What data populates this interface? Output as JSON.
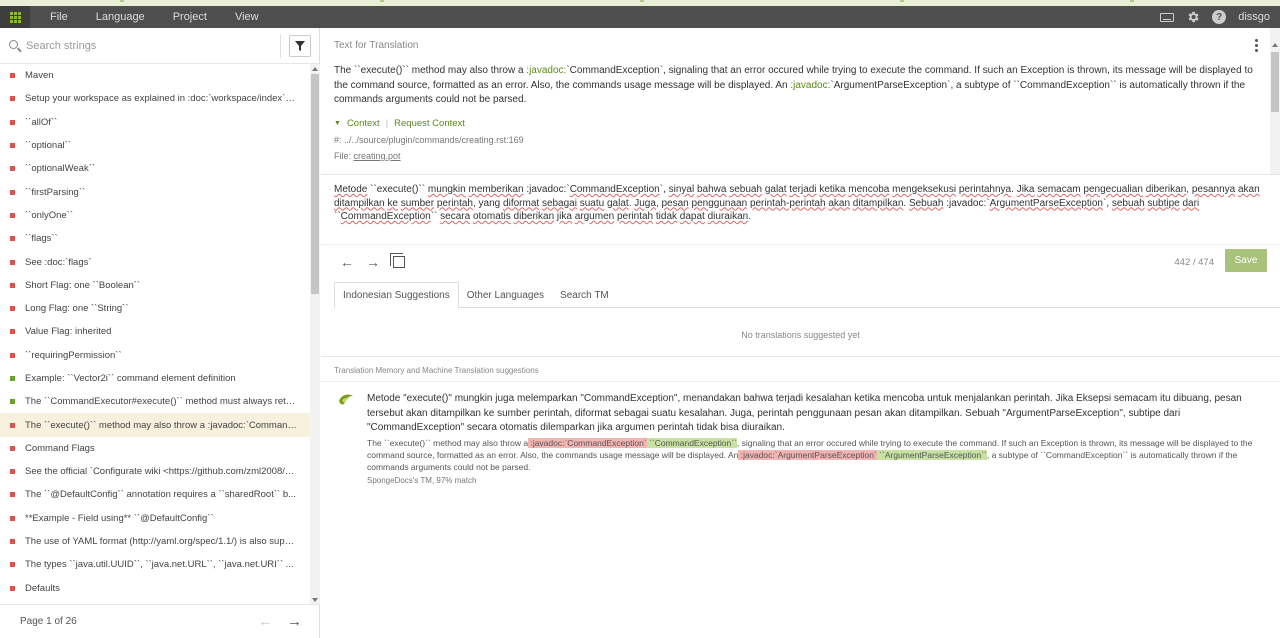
{
  "menubar": {
    "items": [
      "File",
      "Language",
      "Project",
      "View"
    ],
    "user": "dissgo",
    "help_label": "?"
  },
  "sidebar": {
    "search_placeholder": "Search strings",
    "items": [
      {
        "text": "Maven",
        "status": "untranslated"
      },
      {
        "text": "Setup your workspace as explained in :doc:`workspace/index` then...",
        "status": "untranslated"
      },
      {
        "text": "``allOf``",
        "status": "untranslated"
      },
      {
        "text": "``optional``",
        "status": "untranslated"
      },
      {
        "text": "``optionalWeak``",
        "status": "untranslated"
      },
      {
        "text": "``firstParsing``",
        "status": "untranslated"
      },
      {
        "text": "``onlyOne``",
        "status": "untranslated"
      },
      {
        "text": "``flags``",
        "status": "untranslated"
      },
      {
        "text": "See :doc:`flags`",
        "status": "untranslated"
      },
      {
        "text": "Short Flag: one ``Boolean``",
        "status": "untranslated"
      },
      {
        "text": "Long Flag: one ``String``",
        "status": "untranslated"
      },
      {
        "text": "Value Flag: inherited",
        "status": "untranslated"
      },
      {
        "text": "``requiringPermission``",
        "status": "untranslated"
      },
      {
        "text": "Example: ``Vector2i`` command element definition",
        "status": "translated"
      },
      {
        "text": "The ``CommandExecutor#execute()`` method must always return...",
        "status": "translated"
      },
      {
        "text": "The ``execute()`` method may also throw a :javadoc:`Command...",
        "status": "untranslated",
        "active": true
      },
      {
        "text": "Command Flags",
        "status": "untranslated"
      },
      {
        "text": "See the official `Configurate wiki <https://github.com/zml2008/co...",
        "status": "untranslated"
      },
      {
        "text": "The ``@DefaultConfig`` annotation requires a ``sharedRoot`` b...",
        "status": "untranslated"
      },
      {
        "text": "**Example - Field using** ``@DefaultConfig``",
        "status": "untranslated"
      },
      {
        "text": "The use of YAML format (http://yaml.org/spec/1.1/) is also support...",
        "status": "untranslated"
      },
      {
        "text": "The types ``java.util.UUID``, ``java.net.URL``, ``java.net.URI`` ...",
        "status": "untranslated"
      },
      {
        "text": "Defaults",
        "status": "untranslated"
      }
    ],
    "pager": "Page 1 of 26",
    "prev_icon": "←",
    "next_icon": "→"
  },
  "colors": {
    "untranslated": "#d9534f",
    "translated": "#6aa32b",
    "accent": "#5b8a15",
    "save_button": "#a9c27a"
  },
  "main": {
    "source_header": "Text for Translation",
    "source_parts": [
      {
        "t": "The ``execute()`` method may also throw a ",
        "g": false
      },
      {
        "t": ":javadoc:",
        "g": true
      },
      {
        "t": "`CommandException`, signaling that an error occured while trying to execute the command. If such an Exception is thrown, its message will be displayed to the command source, formatted as an error. Also, the commands usage message will be displayed. An ",
        "g": false
      },
      {
        "t": ":javadoc:",
        "g": true
      },
      {
        "t": "`ArgumentParseException`, a subtype of ``CommandException`` is automatically thrown if the commands arguments could not be parsed.",
        "g": false
      }
    ],
    "context_label": "Context",
    "request_context_label": "Request Context",
    "location": "#: ../../source/plugin/commands/creating.rst:169",
    "file_prefix": "File: ",
    "file_name": "creating.pot",
    "target_parts": [
      {
        "t": "Metode",
        "u": true
      },
      {
        "t": " ``execute()`` ",
        "u": false
      },
      {
        "t": "mungkin",
        "u": true
      },
      {
        "t": " ",
        "u": false
      },
      {
        "t": "memberikan",
        "u": true
      },
      {
        "t": " :javadoc:`",
        "u": false
      },
      {
        "t": "CommandException",
        "u": true
      },
      {
        "t": "`, ",
        "u": false
      },
      {
        "t": "sinyal",
        "u": true
      },
      {
        "t": " ",
        "u": false
      },
      {
        "t": "bahwa",
        "u": true
      },
      {
        "t": " ",
        "u": false
      },
      {
        "t": "sebuah",
        "u": true
      },
      {
        "t": " ",
        "u": false
      },
      {
        "t": "galat",
        "u": true
      },
      {
        "t": " ",
        "u": false
      },
      {
        "t": "terjadi",
        "u": true
      },
      {
        "t": " ",
        "u": false
      },
      {
        "t": "ketika",
        "u": true
      },
      {
        "t": " ",
        "u": false
      },
      {
        "t": "mencoba",
        "u": true
      },
      {
        "t": " ",
        "u": false
      },
      {
        "t": "mengeksekusi",
        "u": true
      },
      {
        "t": " ",
        "u": false
      },
      {
        "t": "perintahnya",
        "u": true
      },
      {
        "t": ". ",
        "u": false
      },
      {
        "t": "Jika",
        "u": true
      },
      {
        "t": " ",
        "u": false
      },
      {
        "t": "semacam",
        "u": true
      },
      {
        "t": " ",
        "u": false
      },
      {
        "t": "pengecualian",
        "u": true
      },
      {
        "t": " ",
        "u": false
      },
      {
        "t": "diberikan",
        "u": true
      },
      {
        "t": ", ",
        "u": false
      },
      {
        "t": "pesannya",
        "u": true
      },
      {
        "t": " ",
        "u": false
      },
      {
        "t": "akan",
        "u": true
      },
      {
        "t": " ",
        "u": false
      },
      {
        "t": "ditampilkan",
        "u": true
      },
      {
        "t": " ",
        "u": false
      },
      {
        "t": "ke",
        "u": true
      },
      {
        "t": " ",
        "u": false
      },
      {
        "t": "sumber",
        "u": true
      },
      {
        "t": " ",
        "u": false
      },
      {
        "t": "perintah",
        "u": true
      },
      {
        "t": ", yang ",
        "u": false
      },
      {
        "t": "diformat",
        "u": true
      },
      {
        "t": " ",
        "u": false
      },
      {
        "t": "sebagai",
        "u": true
      },
      {
        "t": " ",
        "u": false
      },
      {
        "t": "suatu",
        "u": true
      },
      {
        "t": " ",
        "u": false
      },
      {
        "t": "galat",
        "u": true
      },
      {
        "t": ". ",
        "u": false
      },
      {
        "t": "Juga",
        "u": true
      },
      {
        "t": ", ",
        "u": false
      },
      {
        "t": "pesan",
        "u": true
      },
      {
        "t": " ",
        "u": false
      },
      {
        "t": "penggunaan",
        "u": true
      },
      {
        "t": " ",
        "u": false
      },
      {
        "t": "perintah-perintah",
        "u": true
      },
      {
        "t": " ",
        "u": false
      },
      {
        "t": "akan",
        "u": true
      },
      {
        "t": " ",
        "u": false
      },
      {
        "t": "ditampilkan",
        "u": true
      },
      {
        "t": ". ",
        "u": false
      },
      {
        "t": "Sebuah",
        "u": true
      },
      {
        "t": " :javadoc:`",
        "u": false
      },
      {
        "t": "ArgumentParseException",
        "u": true
      },
      {
        "t": "`, ",
        "u": false
      },
      {
        "t": "sebuah",
        "u": true
      },
      {
        "t": " ",
        "u": false
      },
      {
        "t": "subtipe",
        "u": true
      },
      {
        "t": " ",
        "u": false
      },
      {
        "t": "dari",
        "u": true
      },
      {
        "t": " ``",
        "u": false
      },
      {
        "t": "CommandException",
        "u": true
      },
      {
        "t": "`` ",
        "u": false
      },
      {
        "t": "secara",
        "u": true
      },
      {
        "t": " ",
        "u": false
      },
      {
        "t": "otomatis",
        "u": true
      },
      {
        "t": " ",
        "u": false
      },
      {
        "t": "diberikan",
        "u": true
      },
      {
        "t": " ",
        "u": false
      },
      {
        "t": "jika",
        "u": true
      },
      {
        "t": " ",
        "u": false
      },
      {
        "t": "argumen",
        "u": true
      },
      {
        "t": " ",
        "u": false
      },
      {
        "t": "perintah",
        "u": true
      },
      {
        "t": " ",
        "u": false
      },
      {
        "t": "tidak",
        "u": true
      },
      {
        "t": " ",
        "u": false
      },
      {
        "t": "dapat",
        "u": true
      },
      {
        "t": " ",
        "u": false
      },
      {
        "t": "diuraikan",
        "u": true
      },
      {
        "t": ".",
        "u": false
      }
    ],
    "counter": "442 / 474",
    "save_label": "Save",
    "tabs": [
      "Indonesian Suggestions",
      "Other Languages",
      "Search TM"
    ],
    "no_suggestions": "No translations suggested yet",
    "tm_label": "Translation Memory and Machine Translation suggestions",
    "suggestion": {
      "text": "Metode \"execute()\" mungkin juga melemparkan \"CommandException\", menandakan bahwa terjadi kesalahan ketika mencoba untuk menjalankan perintah. Jika Eksepsi semacam itu dibuang, pesan tersebut akan ditampilkan ke sumber perintah, diformat sebagai suatu kesalahan. Juga, perintah penggunaan pesan akan ditampilkan. Sebuah \"ArgumentParseException\", subtipe dari \"CommandException\" secara otomatis dilemparkan jika argumen perintah tidak bisa diuraikan.",
      "source_parts": [
        {
          "t": "The ``execute()`` method may also throw a",
          "k": "n"
        },
        {
          "t": " :javadoc:`CommandException`",
          "k": "del"
        },
        {
          "t": " ``CommandException``",
          "k": "ins"
        },
        {
          "t": ", signaling that an error occured while trying to execute the command. If such an Exception is thrown, its message will be displayed to the command source, formatted as an error. Also, the commands usage message will be displayed. An",
          "k": "n"
        },
        {
          "t": " :javadoc:`ArgumentParseException`",
          "k": "del"
        },
        {
          "t": " ``ArgumentParseException``",
          "k": "ins"
        },
        {
          "t": ", a subtype of ``CommandException`` is automatically thrown if the commands arguments could not be parsed.",
          "k": "n"
        }
      ],
      "meta": "SpongeDocs's TM, 97% match"
    }
  }
}
